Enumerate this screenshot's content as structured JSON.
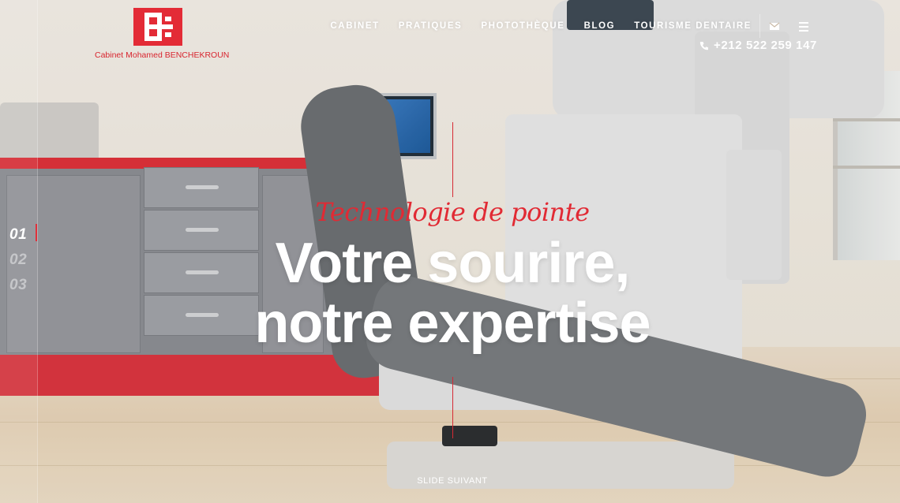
{
  "brand": {
    "logo_caption": "Cabinet Mohamed BENCHEKROUN",
    "accent_color": "#e32b36"
  },
  "nav": {
    "items": [
      "CABINET",
      "PRATIQUES",
      "PHOTOTHÈQUE",
      "BLOG",
      "TOURISME DENTAIRE"
    ],
    "mail_icon": "envelope-icon",
    "menu_icon": "hamburger-menu-icon"
  },
  "contact": {
    "phone": "+212 522 259 147",
    "phone_icon": "phone-icon"
  },
  "slider": {
    "numbers": [
      "01",
      "02",
      "03"
    ],
    "active_index": 0,
    "next_label": "SLIDE SUIVANT"
  },
  "hero": {
    "tagline": "Technologie de pointe",
    "headline_line1": "Votre sourire,",
    "headline_line2": "notre expertise"
  }
}
